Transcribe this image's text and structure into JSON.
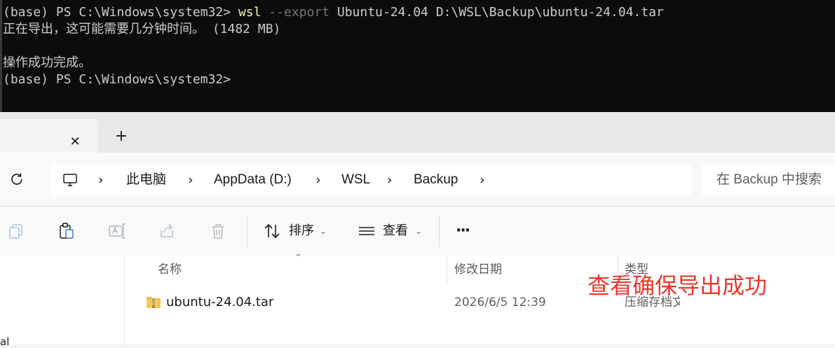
{
  "terminal": {
    "prompt1": "(base) PS C:\\Windows\\system32> ",
    "cmd_name": "wsl",
    "cmd_flag": " --export",
    "cmd_args": " Ubuntu-24.04 D:\\WSL\\Backup\\ubuntu-24.04.tar",
    "line2": "正在导出，这可能需要几分钟时间。 (1482 MB)",
    "line4": "操作成功完成。",
    "prompt2": "(base) PS C:\\Windows\\system32>",
    "colors": {
      "background": "#0c0c0c",
      "text": "#cccccc",
      "command": "#f9f1a5",
      "flag": "#767676"
    }
  },
  "explorer": {
    "tab": {
      "close_glyph": "✕",
      "new_tab_glyph": "+"
    },
    "address": {
      "crumbs": [
        "此电脑",
        "AppData (D:)",
        "WSL",
        "Backup"
      ],
      "chevron": "›"
    },
    "search": {
      "placeholder": "在 Backup 中搜索"
    },
    "toolbar": {
      "sort_label": "排序",
      "view_label": "查看",
      "more_glyph": "···",
      "caret": "⌄"
    },
    "columns": {
      "name": "名称",
      "modified": "修改日期",
      "type": "类型"
    },
    "files": [
      {
        "name": "ubuntu-24.04.tar",
        "modified": "2026/6/5 12:39",
        "type": "压缩存档文件"
      }
    ],
    "nav_peek": "al",
    "sort_indicator": "⌃"
  },
  "annotation": {
    "text": "查看确保导出成功",
    "color": "#e8392d"
  }
}
